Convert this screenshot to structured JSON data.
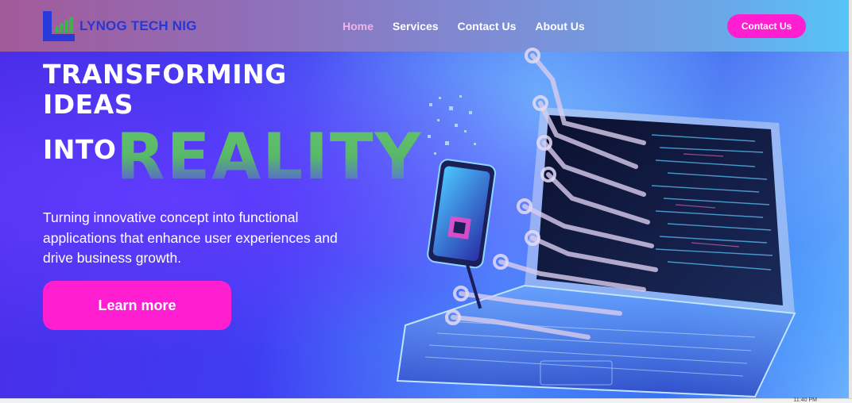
{
  "brand": {
    "name": "LYNOG TECH NIG"
  },
  "nav": {
    "links": [
      {
        "label": "Home",
        "active": true
      },
      {
        "label": "Services"
      },
      {
        "label": "Contact Us"
      },
      {
        "label": "About Us"
      }
    ],
    "cta_label": "Contact Us"
  },
  "hero": {
    "line1": "TRANSFORMING",
    "line2": "IDEAS",
    "line3": "INTO",
    "highlight": "REALITY",
    "subtitle": "Turning innovative concept into functional applications that enhance user experiences and drive business growth.",
    "cta_label": "Learn more",
    "image": {
      "icon": "laptop-circuit-illustration"
    }
  },
  "taskbar": {
    "clock": "11:40 PM"
  },
  "colors": {
    "accent": "#ff1fd0",
    "brand_blue": "#2837d4",
    "brand_green": "#3cb24a",
    "nav_active": "#f3b3e6"
  }
}
